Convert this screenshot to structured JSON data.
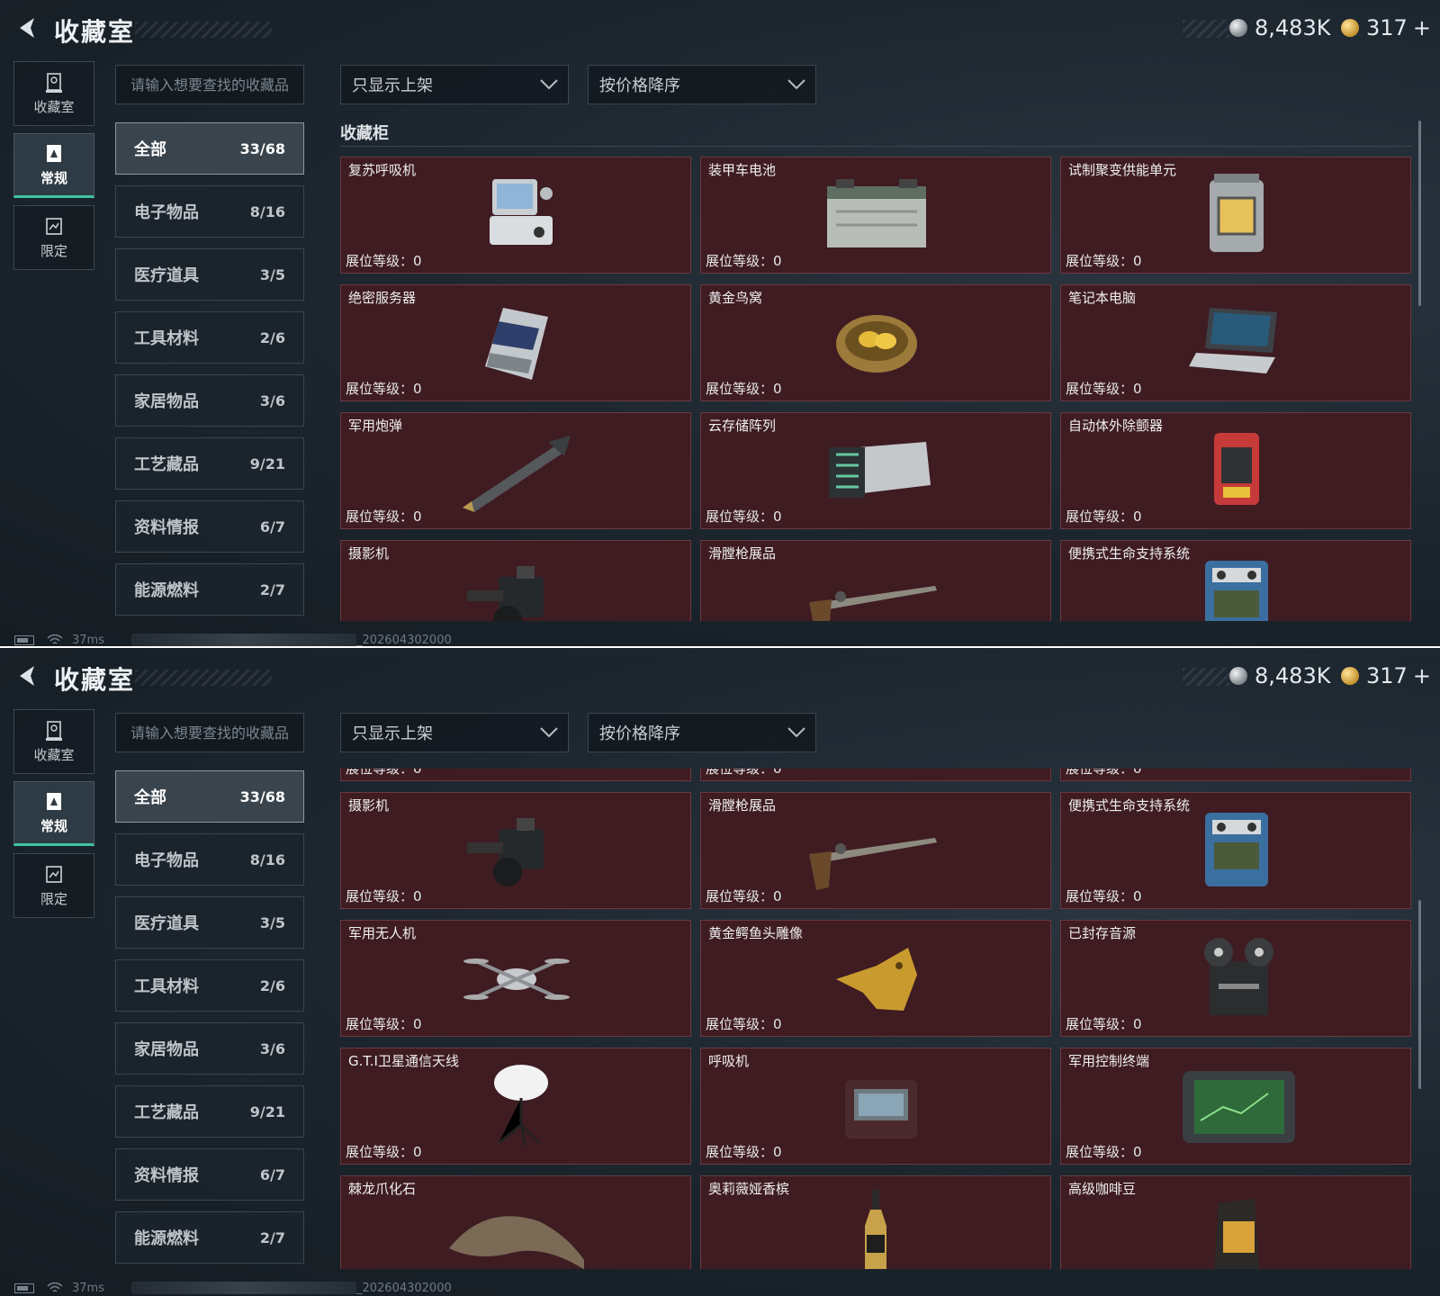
{
  "app": {
    "title": "收藏室",
    "currency": {
      "silver": "8,483K",
      "gold": "317",
      "gold_plus": "+"
    }
  },
  "side_nav": [
    {
      "label": "收藏室",
      "icon": "collection-room-icon",
      "active": false
    },
    {
      "label": "常规",
      "icon": "regular-icon",
      "active": true
    },
    {
      "label": "限定",
      "icon": "limited-icon",
      "active": false
    }
  ],
  "search": {
    "placeholder": "请输入想要查找的收藏品"
  },
  "filters": {
    "display": "只显示上架",
    "sort": "按价格降序"
  },
  "categories": [
    {
      "name": "全部",
      "count": "33/68",
      "active": true
    },
    {
      "name": "电子物品",
      "count": "8/16",
      "active": false
    },
    {
      "name": "医疗道具",
      "count": "3/5",
      "active": false
    },
    {
      "name": "工具材料",
      "count": "2/6",
      "active": false
    },
    {
      "name": "家居物品",
      "count": "3/6",
      "active": false
    },
    {
      "name": "工艺藏品",
      "count": "9/21",
      "active": false
    },
    {
      "name": "资料情报",
      "count": "6/7",
      "active": false
    },
    {
      "name": "能源燃料",
      "count": "2/7",
      "active": false
    }
  ],
  "section_title": "收藏柜",
  "level_label": "展位等级：",
  "level_value": "0",
  "items": [
    {
      "name": "复苏呼吸机",
      "icon": "resuscitator-icon"
    },
    {
      "name": "装甲车电池",
      "icon": "vehicle-battery-icon"
    },
    {
      "name": "试制聚变供能单元",
      "icon": "fusion-unit-icon"
    },
    {
      "name": "绝密服务器",
      "icon": "server-icon"
    },
    {
      "name": "黄金鸟窝",
      "icon": "golden-nest-icon"
    },
    {
      "name": "笔记本电脑",
      "icon": "laptop-icon"
    },
    {
      "name": "军用炮弹",
      "icon": "missile-icon"
    },
    {
      "name": "云存储阵列",
      "icon": "storage-array-icon"
    },
    {
      "name": "自动体外除颤器",
      "icon": "defibrillator-icon"
    },
    {
      "name": "摄影机",
      "icon": "camera-icon"
    },
    {
      "name": "滑膛枪展品",
      "icon": "musket-icon"
    },
    {
      "name": "便携式生命支持系统",
      "icon": "life-support-icon"
    },
    {
      "name": "军用无人机",
      "icon": "drone-icon"
    },
    {
      "name": "黄金鳄鱼头雕像",
      "icon": "golden-crocodile-icon"
    },
    {
      "name": "已封存音源",
      "icon": "reel-recorder-icon"
    },
    {
      "name": "G.T.I卫星通信天线",
      "icon": "satellite-dish-icon"
    },
    {
      "name": "呼吸机",
      "icon": "ventilator-icon"
    },
    {
      "name": "军用控制终端",
      "icon": "control-terminal-icon"
    },
    {
      "name": "棘龙爪化石",
      "icon": "claw-fossil-icon"
    },
    {
      "name": "奥莉薇娅香槟",
      "icon": "champagne-icon"
    },
    {
      "name": "高级咖啡豆",
      "icon": "coffee-bag-icon"
    }
  ],
  "status": {
    "ping": "37ms",
    "build": "202604302000"
  },
  "colors": {
    "card_bg": "#3f1c22",
    "card_border": "#6a3a40",
    "active_tab_accent": "#3fc4a0"
  }
}
